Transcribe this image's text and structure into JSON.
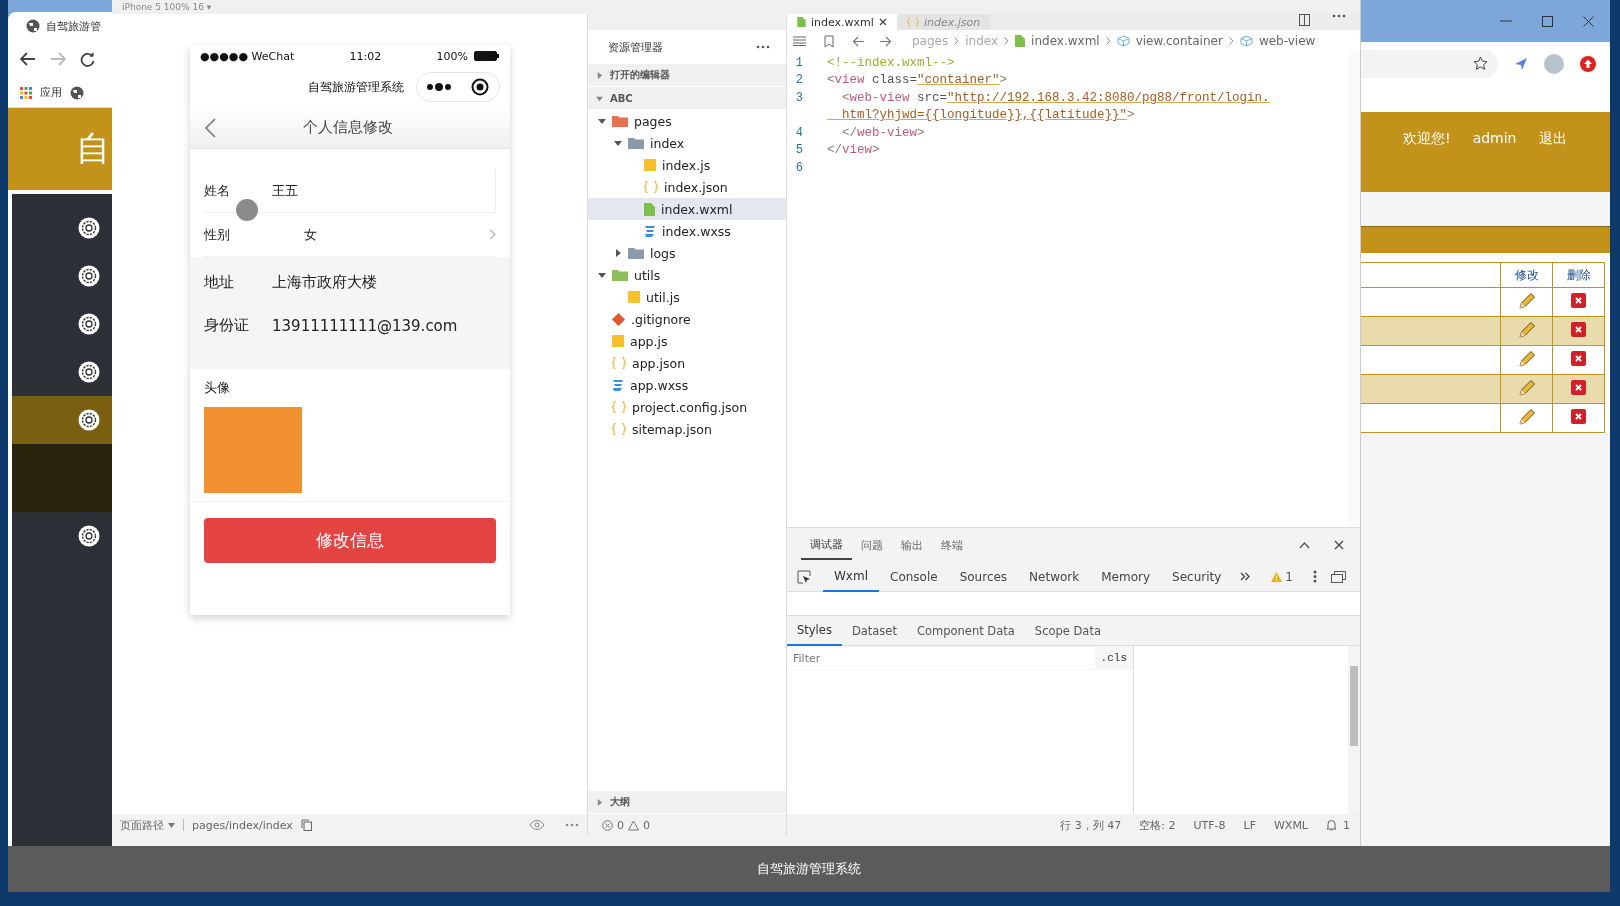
{
  "left_browser": {
    "tab_title": "自驾旅游管",
    "bookmark_label": "应用",
    "header_title": "自",
    "sidebar": {
      "items": [
        {
          "selected": false
        },
        {
          "selected": false
        },
        {
          "selected": false
        },
        {
          "selected": false
        },
        {
          "selected": true
        },
        {
          "selected": false
        }
      ]
    }
  },
  "devtools": {
    "device_label": "iPhone 5 100% 16 ▾",
    "simulator": {
      "status_bar": {
        "carrier": "●●●●● WeChat",
        "time": "11:02",
        "battery": "100%"
      },
      "app_name": "自驾旅游管理系统",
      "page_title": "个人信息修改",
      "form_groups": [
        {
          "fields": [
            {
              "label": "姓名",
              "value": "王五",
              "kind": "input"
            },
            {
              "label": "性别",
              "value": "女",
              "kind": "picker"
            }
          ]
        },
        {
          "fields": [
            {
              "label": "地址",
              "value": "上海市政府大楼",
              "kind": "input"
            },
            {
              "label": "身份证",
              "value": "13911111111@139.com",
              "kind": "input"
            }
          ]
        }
      ],
      "avatar_label": "头像",
      "submit_button": "修改信息",
      "path_label": "页面路径",
      "path": "pages/index/index"
    },
    "explorer": {
      "title": "资源管理器",
      "sections": [
        {
          "label": "打开的编辑器",
          "expanded": false
        },
        {
          "label": "ABC",
          "expanded": true,
          "tree": [
            {
              "label": "pages",
              "kind": "folder",
              "expanded": true,
              "selected": false,
              "children": [
                {
                  "label": "index",
                  "kind": "folder",
                  "expanded": true,
                  "selected": false,
                  "children": [
                    {
                      "label": "index.js",
                      "kind": "js",
                      "selected": false
                    },
                    {
                      "label": "index.json",
                      "kind": "json",
                      "selected": false
                    },
                    {
                      "label": "index.wxml",
                      "kind": "wxml",
                      "selected": true
                    },
                    {
                      "label": "index.wxss",
                      "kind": "wxss",
                      "selected": false
                    }
                  ]
                },
                {
                  "label": "logs",
                  "kind": "folder",
                  "expanded": false,
                  "selected": false
                }
              ]
            },
            {
              "label": "utils",
              "kind": "folder",
              "expanded": true,
              "selected": false,
              "children": [
                {
                  "label": "util.js",
                  "kind": "js",
                  "selected": false
                }
              ]
            },
            {
              "label": ".gitignore",
              "kind": "git",
              "selected": false
            },
            {
              "label": "app.js",
              "kind": "js",
              "selected": false
            },
            {
              "label": "app.json",
              "kind": "json",
              "selected": false
            },
            {
              "label": "app.wxss",
              "kind": "wxss",
              "selected": false
            },
            {
              "label": "project.config.json",
              "kind": "json",
              "selected": false
            },
            {
              "label": "sitemap.json",
              "kind": "json",
              "selected": false
            }
          ]
        },
        {
          "label": "大纲",
          "expanded": false
        }
      ],
      "errors": "0",
      "warnings": "0"
    },
    "editor": {
      "tabs": [
        {
          "label": "index.wxml",
          "selected": true
        },
        {
          "label": "index.json",
          "selected": false
        }
      ],
      "breadcrumb": [
        {
          "label": "pages",
          "kind": "folder"
        },
        {
          "label": "index",
          "kind": "folder"
        },
        {
          "label": "index.wxml",
          "kind": "file"
        },
        {
          "label": "view.container",
          "kind": "element"
        },
        {
          "label": "web-view",
          "kind": "element"
        }
      ],
      "lines": [
        {
          "number": "1",
          "segments": [
            [
              {
                "kind": "comment",
                "text": "<!--index.wxml-->"
              }
            ]
          ]
        },
        {
          "number": "2",
          "segments": [
            [
              {
                "kind": "bracket",
                "text": "<"
              },
              {
                "kind": "tag",
                "text": "view"
              },
              {
                "kind": "attr",
                "text": " class="
              },
              {
                "kind": "string",
                "text": "\"container\""
              },
              {
                "kind": "bracket",
                "text": ">"
              }
            ]
          ]
        },
        {
          "number": "3",
          "segments": [
            [
              {
                "kind": "bracket",
                "text": "  <"
              },
              {
                "kind": "tag",
                "text": "web-view"
              },
              {
                "kind": "attr",
                "text": " src="
              },
              {
                "kind": "string",
                "text": "\"http://192.168.3.42:8080/pg88/front/login."
              }
            ],
            [
              {
                "kind": "string",
                "text": "  html?yhjwd={{longitude}},{{latitude}}\""
              },
              {
                "kind": "bracket",
                "text": ">"
              }
            ]
          ]
        },
        {
          "number": "4",
          "segments": [
            [
              {
                "kind": "bracket",
                "text": "  </"
              },
              {
                "kind": "tag",
                "text": "web-view"
              },
              {
                "kind": "bracket",
                "text": ">"
              }
            ]
          ]
        },
        {
          "number": "5",
          "segments": [
            [
              {
                "kind": "bracket",
                "text": "</"
              },
              {
                "kind": "tag",
                "text": "view"
              },
              {
                "kind": "bracket",
                "text": ">"
              }
            ]
          ]
        },
        {
          "number": "6"
        }
      ]
    },
    "debug_panel": {
      "tabs": [
        {
          "label": "调试器",
          "selected": true
        },
        {
          "label": "问题",
          "selected": false
        },
        {
          "label": "输出",
          "selected": false
        },
        {
          "label": "终端",
          "selected": false
        }
      ],
      "devtools_tabs": [
        {
          "label": "Wxml",
          "selected": true
        },
        {
          "label": "Console",
          "selected": false
        },
        {
          "label": "Sources",
          "selected": false
        },
        {
          "label": "Network",
          "selected": false
        },
        {
          "label": "Memory",
          "selected": false
        },
        {
          "label": "Security",
          "selected": false
        }
      ],
      "warning_count": "1",
      "inspector_tabs": [
        {
          "label": "Styles",
          "selected": true
        },
        {
          "label": "Dataset",
          "selected": false
        },
        {
          "label": "Component Data",
          "selected": false
        },
        {
          "label": "Scope Data",
          "selected": false
        }
      ],
      "filter_placeholder": "Filter",
      "cls_button": ".cls"
    },
    "status_bar": {
      "items": [
        "行 3，列 47",
        "空格: 2",
        "UTF-8",
        "LF",
        "WXML"
      ],
      "notifications": "1"
    }
  },
  "right_browser": {
    "header_links": [
      "欢迎您!",
      "admin",
      "退出"
    ],
    "table": {
      "columns": [
        "修改",
        "删除"
      ],
      "rows": [
        {
          "striped": false
        },
        {
          "striped": true
        },
        {
          "striped": false
        },
        {
          "striped": true
        },
        {
          "striped": false
        }
      ]
    }
  },
  "footer": {
    "text": "自驾旅游管理系统"
  }
}
